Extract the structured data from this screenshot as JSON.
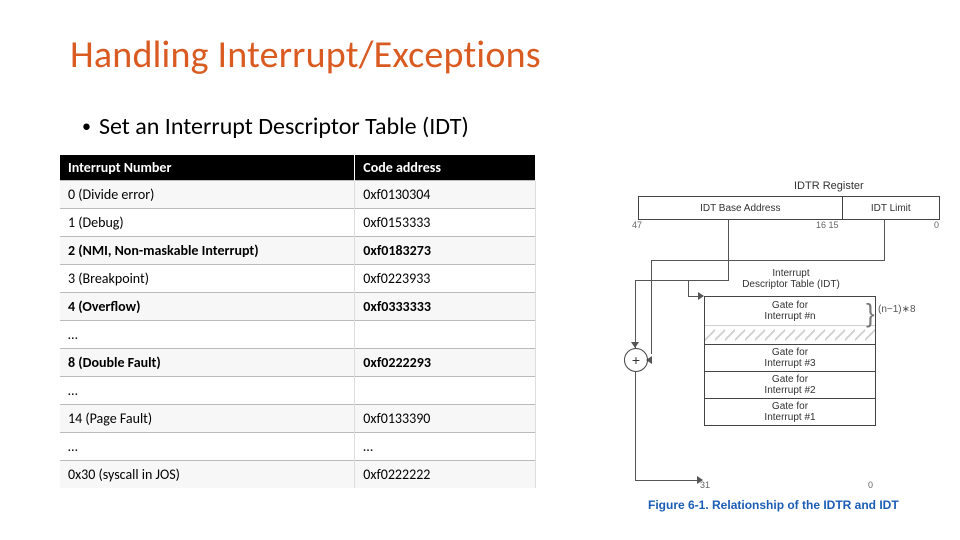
{
  "title": "Handling Interrupt/Exceptions",
  "bullet": "Set an Interrupt Descriptor Table (IDT)",
  "table": {
    "headers": [
      "Interrupt Number",
      "Code address"
    ],
    "rows": [
      [
        "0 (Divide error)",
        "0xf0130304"
      ],
      [
        "1 (Debug)",
        "0xf0153333"
      ],
      [
        "2 (NMI, Non-maskable Interrupt)",
        "0xf0183273"
      ],
      [
        "3 (Breakpoint)",
        "0xf0223933"
      ],
      [
        "4 (Overflow)",
        "0xf0333333"
      ],
      [
        "…",
        ""
      ],
      [
        "8 (Double Fault)",
        "0xf0222293"
      ],
      [
        "…",
        ""
      ],
      [
        "14 (Page Fault)",
        "0xf0133390"
      ],
      [
        "…",
        "…"
      ],
      [
        "0x30 (syscall in JOS)",
        "0xf0222222"
      ]
    ]
  },
  "diagram": {
    "idtr_label": "IDTR Register",
    "idtr_base": "IDT Base Address",
    "idtr_limit": "IDT Limit",
    "tick47": "47",
    "tick1615": "16 15",
    "tick0": "0",
    "idt_title": "Interrupt\nDescriptor Table (IDT)",
    "gate_n": "Gate for\nInterrupt #n",
    "gate3": "Gate for\nInterrupt #3",
    "gate2": "Gate for\nInterrupt #2",
    "gate1": "Gate for\nInterrupt #1",
    "plus": "+",
    "brace_n": "(n−1)∗8",
    "axis31": "31",
    "axis0": "0",
    "caption": "Figure 6-1.  Relationship of the IDTR and IDT"
  }
}
